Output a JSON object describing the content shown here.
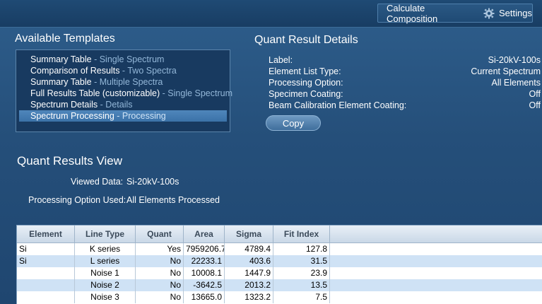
{
  "toolbar": {
    "calculate_label": "Calculate Composition",
    "settings_label": "Settings",
    "settings_icon": "gear-icon"
  },
  "templates": {
    "title": "Available Templates",
    "items": [
      {
        "name": "Summary Table",
        "sub": "Single Spectrum",
        "selected": false
      },
      {
        "name": "Comparison of Results",
        "sub": "Two Spectra",
        "selected": false
      },
      {
        "name": "Summary Table",
        "sub": "Multiple Spectra",
        "selected": false
      },
      {
        "name": "Full Results Table (customizable)",
        "sub": "Single Spectrum",
        "selected": false
      },
      {
        "name": "Spectrum Details",
        "sub": "Details",
        "selected": false
      },
      {
        "name": "Spectrum Processing",
        "sub": "Processing",
        "selected": true
      }
    ]
  },
  "details": {
    "title": "Quant Result Details",
    "rows": [
      {
        "label": "Label:",
        "value": "Si-20kV-100s"
      },
      {
        "label": "Element List Type:",
        "value": "Current Spectrum"
      },
      {
        "label": "Processing Option:",
        "value": "All Elements"
      },
      {
        "label": "Specimen Coating:",
        "value": "Off"
      },
      {
        "label": "Beam Calibration Element Coating:",
        "value": "Off"
      }
    ],
    "copy_label": "Copy"
  },
  "results_view": {
    "title": "Quant Results View",
    "viewed_label": "Viewed Data:",
    "viewed_value": "Si-20kV-100s",
    "option_label": "Processing Option Used:",
    "option_value": "All Elements Processed"
  },
  "table": {
    "columns": [
      "Element",
      "Line Type",
      "Quant",
      "Area",
      "Sigma",
      "Fit Index"
    ],
    "rows": [
      [
        "Si",
        "K series",
        "Yes",
        "7959206.7",
        "4789.4",
        "127.8"
      ],
      [
        "Si",
        "L series",
        "No",
        "22233.1",
        "403.6",
        "31.5"
      ],
      [
        "",
        "Noise 1",
        "No",
        "10008.1",
        "1447.9",
        "23.9"
      ],
      [
        "",
        "Noise 2",
        "No",
        "-3642.5",
        "2013.2",
        "13.5"
      ],
      [
        "",
        "Noise 3",
        "No",
        "13665.0",
        "1323.2",
        "7.5"
      ]
    ]
  }
}
